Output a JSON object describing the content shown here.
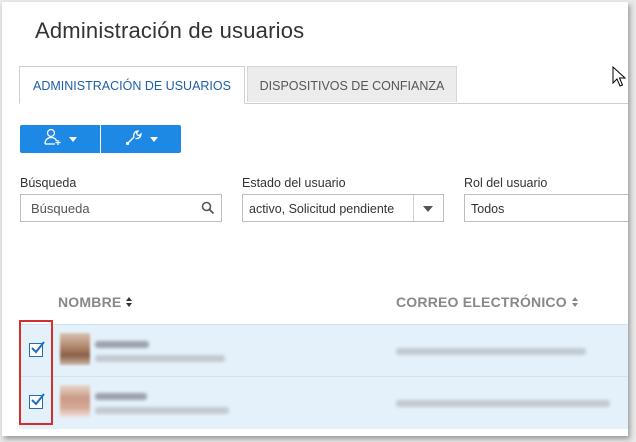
{
  "page": {
    "title": "Administración de usuarios"
  },
  "tabs": [
    {
      "label": "ADMINISTRACIÓN DE USUARIOS",
      "active": true
    },
    {
      "label": "DISPOSITIVOS DE CONFIANZA",
      "active": false
    }
  ],
  "toolbar": {
    "add_user_icon": "add-user-icon",
    "tools_icon": "wrench-icon",
    "accent_color": "#1e88e5"
  },
  "filters": {
    "search": {
      "label": "Búsqueda",
      "placeholder": "Búsqueda"
    },
    "status": {
      "label": "Estado del usuario",
      "value": "activo, Solicitud pendiente"
    },
    "role": {
      "label": "Rol del usuario",
      "value": "Todos"
    }
  },
  "table": {
    "columns": [
      {
        "label": "NOMBRE",
        "sorted": true
      },
      {
        "label": "CORREO ELECTRÓNICO",
        "sorted": false
      }
    ],
    "rows": [
      {
        "selected": true
      },
      {
        "selected": true
      }
    ]
  },
  "highlight_color": "#d3302b"
}
